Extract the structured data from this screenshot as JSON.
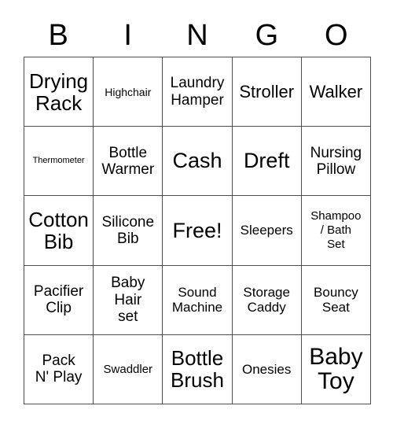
{
  "card": {
    "title": "BINGO Card",
    "columns": [
      "B",
      "I",
      "N",
      "G",
      "O"
    ],
    "grid_color": "#4d4d4d",
    "background_color": "#ffffff",
    "text_color": "#000000",
    "rows": [
      [
        {
          "label": "Drying\nRack",
          "size": "fs-xxl"
        },
        {
          "label": "Highchair",
          "size": "fs-xs"
        },
        {
          "label": "Laundry\nHamper",
          "size": "fs-l"
        },
        {
          "label": "Stroller",
          "size": "fs-xl"
        },
        {
          "label": "Walker",
          "size": "fs-xl"
        }
      ],
      [
        {
          "label": "Thermometer",
          "size": "fs-xxs"
        },
        {
          "label": "Bottle\nWarmer",
          "size": "fs-l"
        },
        {
          "label": "Cash",
          "size": "fs-3xl"
        },
        {
          "label": "Dreft",
          "size": "fs-3xl"
        },
        {
          "label": "Nursing\nPillow",
          "size": "fs-l"
        }
      ],
      [
        {
          "label": "Cotton\nBib",
          "size": "fs-xxl"
        },
        {
          "label": "Silicone\nBib",
          "size": "fs-l"
        },
        {
          "label": "Free!",
          "size": "fs-3xl"
        },
        {
          "label": "Sleepers",
          "size": "fs-m"
        },
        {
          "label": "Shampoo\n/ Bath\nSet",
          "size": "fs-s"
        }
      ],
      [
        {
          "label": "Pacifier\nClip",
          "size": "fs-l"
        },
        {
          "label": "Baby\nHair\nset",
          "size": "fs-l"
        },
        {
          "label": "Sound\nMachine",
          "size": "fs-m"
        },
        {
          "label": "Storage\nCaddy",
          "size": "fs-m"
        },
        {
          "label": "Bouncy\nSeat",
          "size": "fs-m"
        }
      ],
      [
        {
          "label": "Pack\nN' Play",
          "size": "fs-l"
        },
        {
          "label": "Swaddler",
          "size": "fs-s"
        },
        {
          "label": "Bottle\nBrush",
          "size": "fs-xxl"
        },
        {
          "label": "Onesies",
          "size": "fs-m"
        },
        {
          "label": "Baby\nToy",
          "size": "fs-4xl"
        }
      ]
    ]
  }
}
